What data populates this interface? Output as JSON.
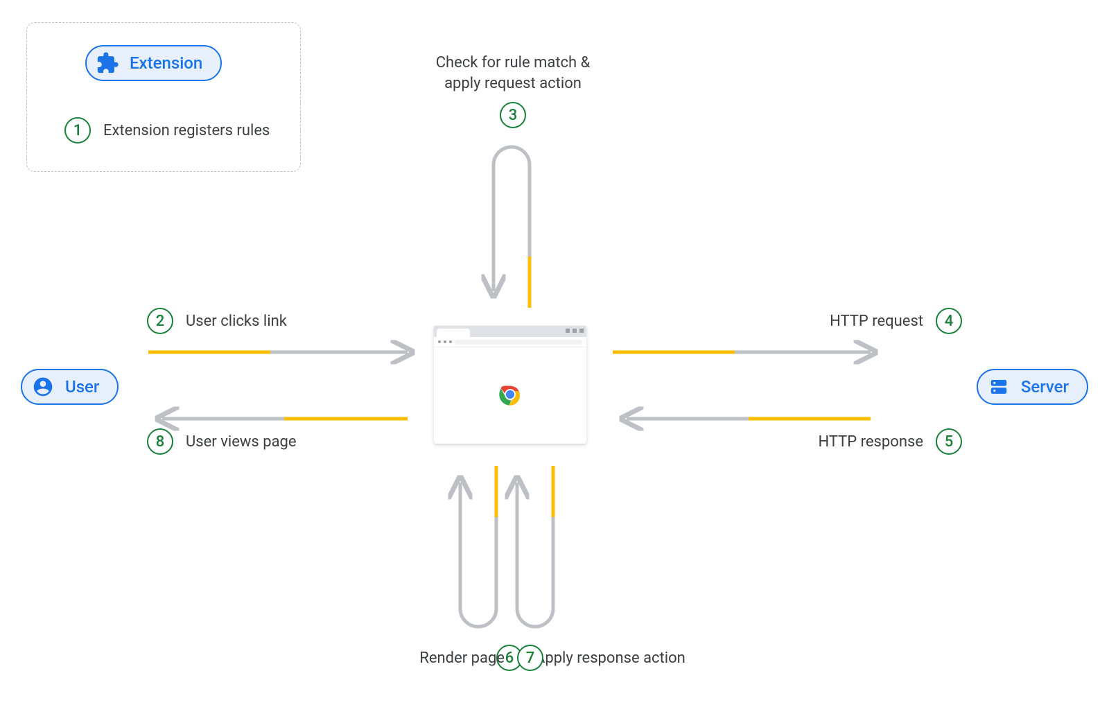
{
  "nodes": {
    "extension": "Extension",
    "user": "User",
    "server": "Server"
  },
  "steps": {
    "1": "Extension registers rules",
    "2": "User clicks link",
    "3": "Check for rule match &\napply request action",
    "4": "HTTP request",
    "5": "HTTP response",
    "6": "Apply response action",
    "7": "Render page",
    "8": "User views page"
  },
  "colors": {
    "blue": "#1a73e8",
    "blueFill": "#e8f0fe",
    "green": "#188038",
    "grey": "#bdc1c6",
    "orange": "#fbbc04",
    "text": "#3c4043"
  }
}
